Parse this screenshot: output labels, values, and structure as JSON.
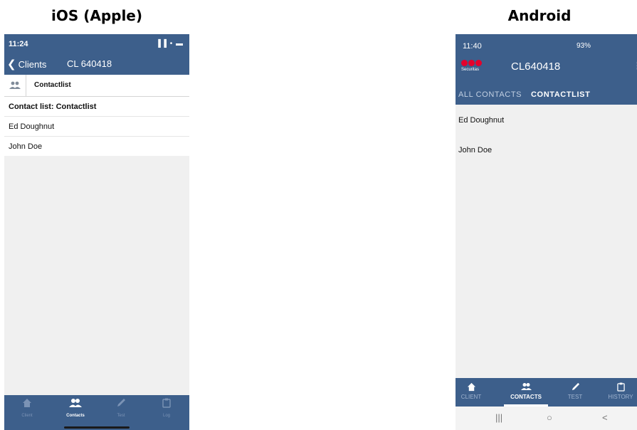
{
  "captions": {
    "ios": "iOS (Apple)",
    "android": "Android"
  },
  "ios": {
    "status_time": "11:24",
    "status_icons": "▐▐ • ▬",
    "back_label": "Clients",
    "title": "CL 640418",
    "tab_label": "Contactlist",
    "list_title": "Contact list: Contactlist",
    "contacts": [
      "Ed Doughnut",
      "John Doe"
    ],
    "bottom_tabs": [
      {
        "label": "Client",
        "icon": "home-icon"
      },
      {
        "label": "Contacts",
        "icon": "contacts-icon",
        "active": true
      },
      {
        "label": "Test",
        "icon": "pencil-icon"
      },
      {
        "label": "Log",
        "icon": "clipboard-icon"
      }
    ]
  },
  "android": {
    "status_time": "11:40",
    "status_icons": "93%",
    "logo_text": "Securitas",
    "title": "CL640418",
    "tabs": [
      "ALL CONTACTS",
      "CONTACTLIST"
    ],
    "contacts": [
      "Ed Doughnut",
      "John Doe"
    ],
    "bottom_tabs": [
      {
        "label": "CLIENT",
        "icon": "home-icon"
      },
      {
        "label": "CONTACTS",
        "icon": "contacts-icon",
        "active": true
      },
      {
        "label": "TEST",
        "icon": "pencil-icon"
      },
      {
        "label": "HISTORY",
        "icon": "clipboard-icon"
      }
    ],
    "nav_buttons": [
      "|||",
      "○",
      "<"
    ]
  },
  "colors": {
    "header_blue": "#3d5f8b",
    "brand_red": "#e4002b"
  }
}
